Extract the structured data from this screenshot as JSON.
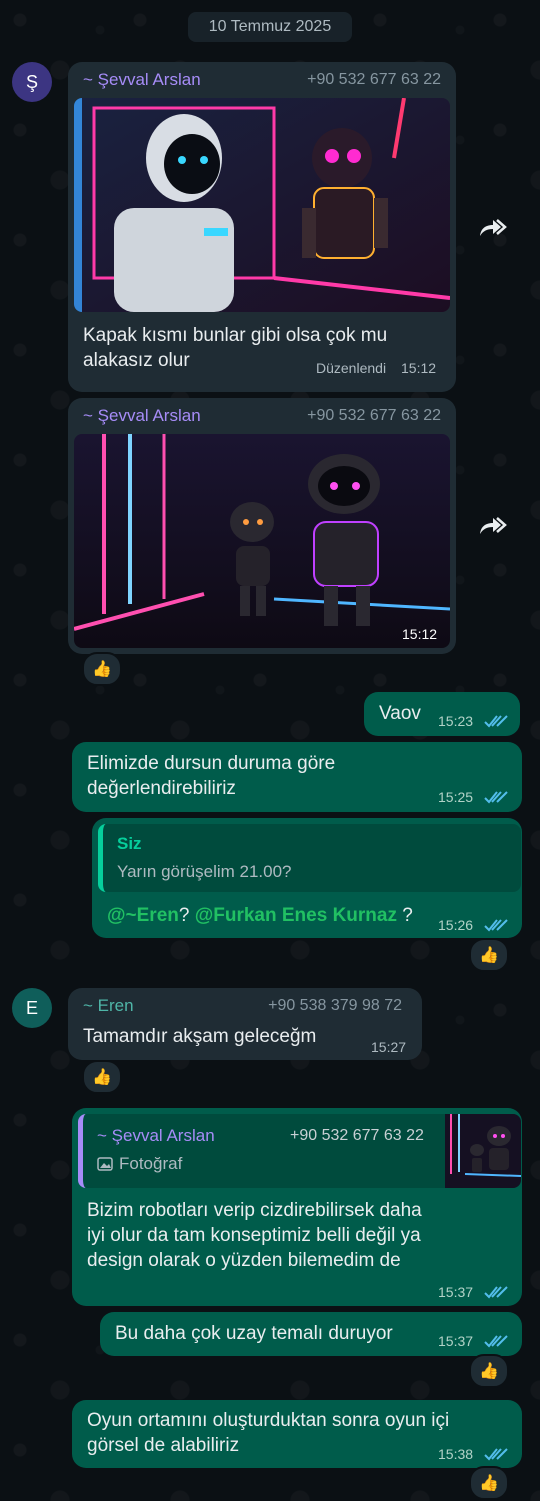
{
  "date_chip": "10 Temmuz 2025",
  "messages": {
    "m1": {
      "avatar": "Ş",
      "sender": "~ Şevval Arslan",
      "phone": "+90 532 677 63 22",
      "text_line1": "Kapak kısmı bunlar gibi olsa çok mu",
      "text_line2": "alakasız olur",
      "edited": "Düzenlendi",
      "time": "15:12"
    },
    "m2": {
      "sender": "~ Şevval Arslan",
      "phone": "+90 532 677 63 22",
      "time": "15:12",
      "reaction": "thumbs-up"
    },
    "m3": {
      "text": "Vaov",
      "time": "15:23"
    },
    "m4": {
      "text_line1": "Elimizde dursun duruma göre",
      "text_line2": "değerlendirebiliriz",
      "time": "15:25"
    },
    "m5": {
      "quote_sender": "Siz",
      "quote_text": "Yarın görüşelim 21.00?",
      "mention1": "@~Eren",
      "sep1": "? ",
      "mention2": "@Furkan Enes Kurnaz",
      "sep2": " ?",
      "time": "15:26",
      "reaction": "thumbs-up"
    },
    "m6": {
      "avatar": "E",
      "sender": "~ Eren",
      "phone": "+90 538 379 98 72",
      "text": "Tamamdır akşam geleceğm",
      "time": "15:27",
      "reaction": "thumbs-up"
    },
    "m7": {
      "quote_sender": "~ Şevval Arslan",
      "quote_phone": "+90 532 677 63 22",
      "quote_type": "Fotoğraf",
      "text_line1": "Bizim robotları verip cizdirebilirsek daha",
      "text_line2": "iyi olur da tam konseptimiz belli değil ya",
      "text_line3": "design olarak o yüzden bilemedim de",
      "time": "15:37"
    },
    "m8": {
      "text": "Bu daha çok uzay temalı duruyor",
      "time": "15:37",
      "reaction": "thumbs-up"
    },
    "m9": {
      "text_line1": "Oyun ortamını oluşturduktan sonra oyun içi",
      "text_line2": "görsel de alabiliriz",
      "time": "15:38",
      "reaction": "thumbs-up"
    }
  },
  "colors": {
    "incoming_bubble": "#1f2c34",
    "outgoing_bubble": "#005c4b",
    "mention": "#21c063",
    "read_ticks": "#53bdeb"
  }
}
